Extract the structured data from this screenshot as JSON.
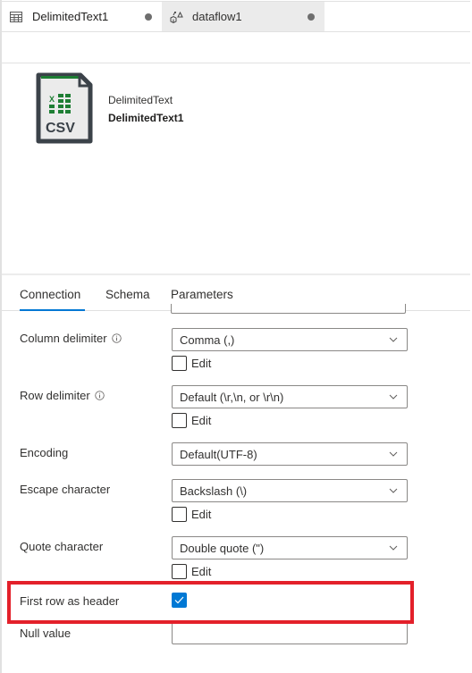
{
  "tabs": [
    {
      "label": "DelimitedText1",
      "icon": "table-icon",
      "active": true,
      "unsaved": true
    },
    {
      "label": "dataflow1",
      "icon": "dataflow-icon",
      "active": false,
      "unsaved": true
    }
  ],
  "dataset": {
    "icon": "csv-file-icon",
    "icon_label": "CSV",
    "type": "DelimitedText",
    "name": "DelimitedText1"
  },
  "property_tabs": [
    {
      "label": "Connection",
      "active": true
    },
    {
      "label": "Schema",
      "active": false
    },
    {
      "label": "Parameters",
      "active": false
    }
  ],
  "form": {
    "column_delimiter": {
      "label": "Column delimiter",
      "has_info": true,
      "value": "Comma (,)",
      "edit_label": "Edit",
      "edit_checked": false
    },
    "row_delimiter": {
      "label": "Row delimiter",
      "has_info": true,
      "value": "Default (\\r,\\n, or \\r\\n)",
      "edit_label": "Edit",
      "edit_checked": false
    },
    "encoding": {
      "label": "Encoding",
      "value": "Default(UTF-8)"
    },
    "escape_character": {
      "label": "Escape character",
      "value": "Backslash (\\)",
      "edit_label": "Edit",
      "edit_checked": false
    },
    "quote_character": {
      "label": "Quote character",
      "value": "Double quote (\")",
      "edit_label": "Edit",
      "edit_checked": false
    },
    "first_row_as_header": {
      "label": "First row as header",
      "checked": true
    },
    "null_value": {
      "label": "Null value",
      "value": ""
    }
  },
  "colors": {
    "accent": "#0078d4",
    "highlight": "#e3202a",
    "csv_green": "#1e7e34"
  }
}
